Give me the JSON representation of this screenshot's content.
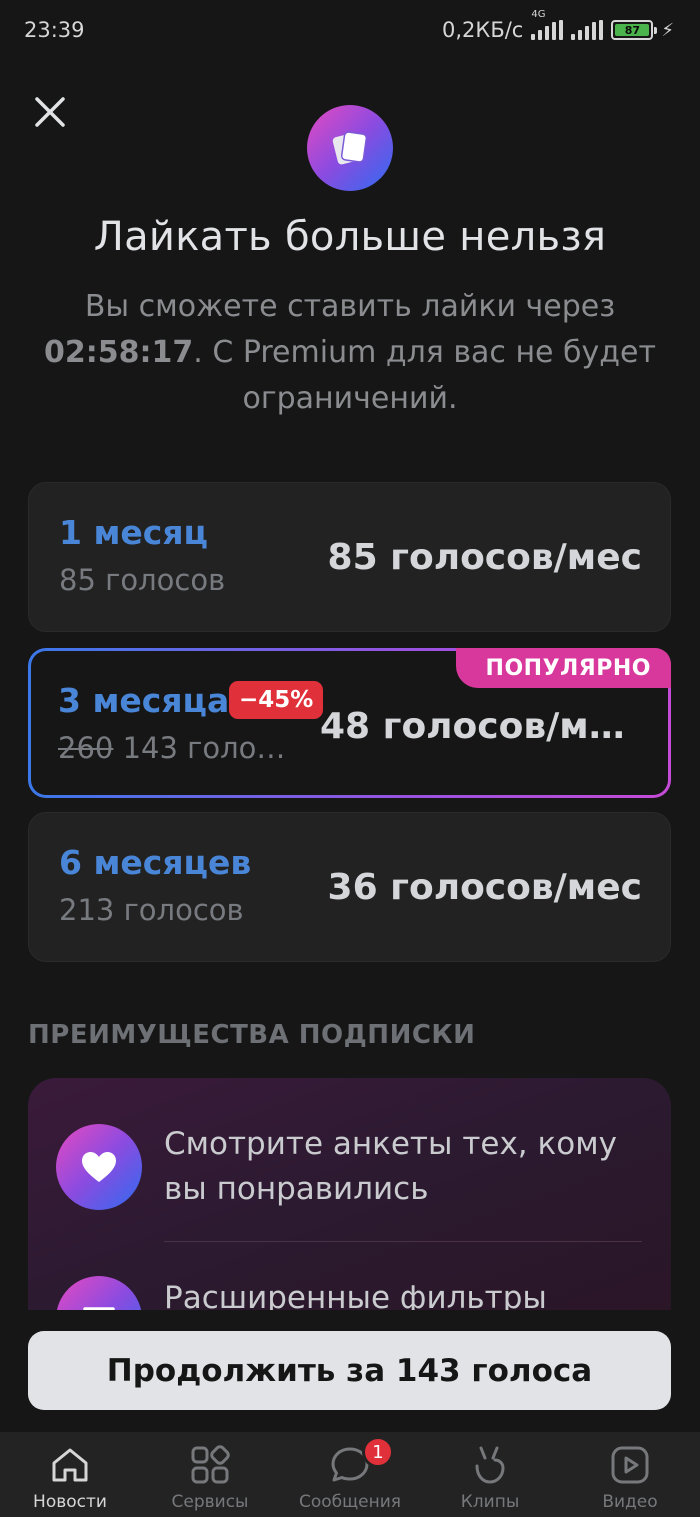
{
  "status_bar": {
    "time": "23:39",
    "net_speed": "0,2КБ/с",
    "network_type": "4G",
    "battery": "87"
  },
  "header": {
    "title": "Лайкать больше нельзя",
    "subtitle_before": "Вы сможете ставить лайки через ",
    "timer": "02:58:17",
    "subtitle_after": ". С Premium для вас не будет ограничений."
  },
  "plans": [
    {
      "name": "1 месяц",
      "total": "85 голосов",
      "price": "85 голосов/мес"
    },
    {
      "name": "3 месяца",
      "discount": "−45%",
      "old_total": "260",
      "total": "143 голо…",
      "price": "48 голосов/м…",
      "badge": "ПОПУЛЯРНО"
    },
    {
      "name": "6 месяцев",
      "total": "213 голосов",
      "price": "36 голосов/мес"
    }
  ],
  "benefits": {
    "header": "ПРЕИМУЩЕСТВА ПОДПИСКИ",
    "items": [
      {
        "text": "Смотрите анкеты тех, кому вы понравились",
        "icon": "heart-icon"
      },
      {
        "text": "Расширенные фильтры",
        "icon": "filter-icon"
      }
    ]
  },
  "cta": {
    "label": "Продолжить за 143 голоса"
  },
  "tabs": [
    {
      "label": "Новости",
      "icon": "home-icon",
      "active": true
    },
    {
      "label": "Сервисы",
      "icon": "services-icon"
    },
    {
      "label": "Сообщения",
      "icon": "messages-icon",
      "badge": "1"
    },
    {
      "label": "Клипы",
      "icon": "clips-icon"
    },
    {
      "label": "Видео",
      "icon": "video-icon"
    }
  ],
  "colors": {
    "background": "#161616",
    "accent_blue": "#4a86d8",
    "popular_badge": "#d8389c",
    "discount_badge": "#e0303a"
  }
}
